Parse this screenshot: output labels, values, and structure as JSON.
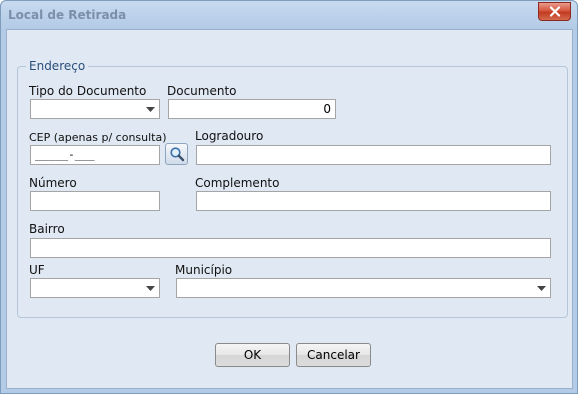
{
  "window": {
    "title": "Local de Retirada"
  },
  "group": {
    "legend": "Endereço"
  },
  "fields": {
    "tipo_documento": {
      "label": "Tipo do Documento",
      "value": ""
    },
    "documento": {
      "label": "Documento",
      "value": "0"
    },
    "cep": {
      "label": "CEP (apenas p/ consulta)",
      "value": "_____-___"
    },
    "logradouro": {
      "label": "Logradouro",
      "value": ""
    },
    "numero": {
      "label": "Número",
      "value": ""
    },
    "complemento": {
      "label": "Complemento",
      "value": ""
    },
    "bairro": {
      "label": "Bairro",
      "value": ""
    },
    "uf": {
      "label": "UF",
      "value": ""
    },
    "municipio": {
      "label": "Município",
      "value": ""
    }
  },
  "buttons": {
    "ok": "OK",
    "cancel": "Cancelar"
  },
  "icons": {
    "close": "close-icon",
    "search": "magnifier-icon",
    "dropdown": "chevron-down-icon"
  },
  "colors": {
    "title_text": "#7b8fa8",
    "close_button": "#c9452c",
    "legend_text": "#2a4e7a",
    "client_bg": "#dfe8f3"
  }
}
